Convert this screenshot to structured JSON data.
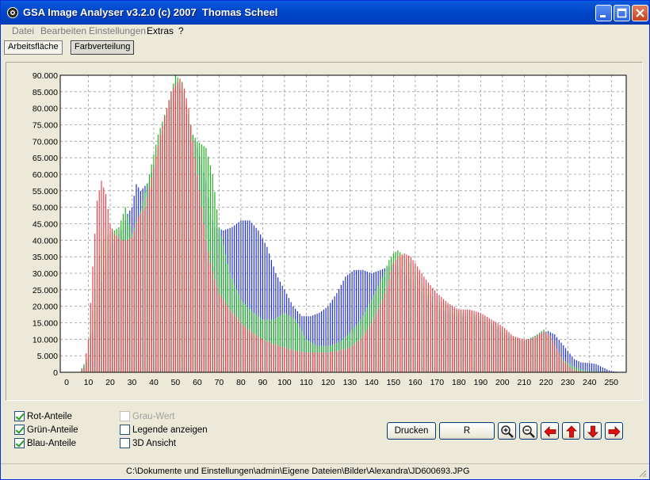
{
  "window": {
    "title": "GSA Image Analyser v3.2.0 (c) 2007  Thomas Scheel"
  },
  "menu": [
    "Datei",
    "Bearbeiten",
    "Einstellungen",
    "Extras",
    "?"
  ],
  "tabs": [
    "Arbeitsfläche",
    "Farbverteilung"
  ],
  "checkboxes": {
    "rot": {
      "label": "Rot-Anteile",
      "checked": true
    },
    "gruen": {
      "label": "Grün-Anteile",
      "checked": true
    },
    "blau": {
      "label": "Blau-Anteile",
      "checked": true
    },
    "grau": {
      "label": "Grau-Wert",
      "checked": false,
      "disabled": true
    },
    "legende": {
      "label": "Legende anzeigen",
      "checked": false
    },
    "ansicht3d": {
      "label": "3D Ansicht",
      "checked": false
    }
  },
  "buttons": {
    "drucken": "Drucken",
    "reset": "R"
  },
  "icons": [
    "zoom-in-icon",
    "zoom-out-icon",
    "arrow-left-icon",
    "arrow-up-icon",
    "arrow-down-icon",
    "arrow-right-icon"
  ],
  "status": {
    "path": "C:\\Dokumente und Einstellungen\\admin\\Eigene Dateien\\Bilder\\Alexandra\\JD600693.JPG"
  },
  "colors": {
    "red": "#e8434a",
    "green": "#1fb21f",
    "blue": "#1f2fd6"
  },
  "chart_data": {
    "type": "bar",
    "ylim": [
      0,
      90000
    ],
    "xlim": [
      0,
      255
    ],
    "y_ticks": [
      "0",
      "5.000",
      "10.000",
      "15.000",
      "20.000",
      "25.000",
      "30.000",
      "35.000",
      "40.000",
      "45.000",
      "50.000",
      "55.000",
      "60.000",
      "65.000",
      "70.000",
      "75.000",
      "80.000",
      "85.000",
      "90.000"
    ],
    "x_ticks": [
      "0",
      "10",
      "20",
      "30",
      "40",
      "50",
      "60",
      "70",
      "80",
      "90",
      "100",
      "110",
      "120",
      "130",
      "140",
      "150",
      "160",
      "170",
      "180",
      "190",
      "200",
      "210",
      "220",
      "230",
      "240",
      "250"
    ],
    "grid": true,
    "series": [
      {
        "name": "Rot-Anteile",
        "color": "#e8434a",
        "points": [
          [
            0,
            0
          ],
          [
            6,
            0
          ],
          [
            8,
            1500
          ],
          [
            10,
            10000
          ],
          [
            12,
            32000
          ],
          [
            14,
            52000
          ],
          [
            16,
            58000
          ],
          [
            18,
            54000
          ],
          [
            20,
            45000
          ],
          [
            22,
            42000
          ],
          [
            25,
            40000
          ],
          [
            28,
            40000
          ],
          [
            30,
            41000
          ],
          [
            33,
            47000
          ],
          [
            36,
            50000
          ],
          [
            40,
            62000
          ],
          [
            43,
            72000
          ],
          [
            46,
            80000
          ],
          [
            48,
            85000
          ],
          [
            50,
            87000
          ],
          [
            52,
            89000
          ],
          [
            54,
            86000
          ],
          [
            56,
            80000
          ],
          [
            58,
            70000
          ],
          [
            60,
            60000
          ],
          [
            62,
            50000
          ],
          [
            64,
            40000
          ],
          [
            66,
            33000
          ],
          [
            68,
            28000
          ],
          [
            70,
            24000
          ],
          [
            75,
            19000
          ],
          [
            80,
            15000
          ],
          [
            85,
            12000
          ],
          [
            90,
            10000
          ],
          [
            95,
            8500
          ],
          [
            100,
            7500
          ],
          [
            105,
            6500
          ],
          [
            110,
            6000
          ],
          [
            115,
            6000
          ],
          [
            120,
            6000
          ],
          [
            125,
            6500
          ],
          [
            130,
            7500
          ],
          [
            135,
            10000
          ],
          [
            140,
            15000
          ],
          [
            145,
            22000
          ],
          [
            148,
            28000
          ],
          [
            150,
            33000
          ],
          [
            152,
            35000
          ],
          [
            155,
            36000
          ],
          [
            158,
            35000
          ],
          [
            160,
            33000
          ],
          [
            165,
            28000
          ],
          [
            170,
            24000
          ],
          [
            175,
            21000
          ],
          [
            180,
            19000
          ],
          [
            185,
            19000
          ],
          [
            190,
            18000
          ],
          [
            195,
            16000
          ],
          [
            200,
            14000
          ],
          [
            205,
            11000
          ],
          [
            210,
            10000
          ],
          [
            213,
            10000
          ],
          [
            216,
            11000
          ],
          [
            219,
            12500
          ],
          [
            222,
            11000
          ],
          [
            225,
            7000
          ],
          [
            228,
            3500
          ],
          [
            231,
            1500
          ],
          [
            234,
            400
          ],
          [
            240,
            100
          ],
          [
            255,
            0
          ]
        ]
      },
      {
        "name": "Grün-Anteile",
        "color": "#1fb21f",
        "points": [
          [
            0,
            0
          ],
          [
            6,
            0
          ],
          [
            10,
            5000
          ],
          [
            13,
            25000
          ],
          [
            16,
            40000
          ],
          [
            20,
            42000
          ],
          [
            24,
            44000
          ],
          [
            27,
            50000
          ],
          [
            30,
            42000
          ],
          [
            34,
            49000
          ],
          [
            38,
            60000
          ],
          [
            42,
            72000
          ],
          [
            46,
            80000
          ],
          [
            50,
            90000
          ],
          [
            53,
            88000
          ],
          [
            56,
            78000
          ],
          [
            58,
            72000
          ],
          [
            60,
            70000
          ],
          [
            64,
            68000
          ],
          [
            67,
            60000
          ],
          [
            70,
            44000
          ],
          [
            75,
            30000
          ],
          [
            80,
            22000
          ],
          [
            85,
            18500
          ],
          [
            90,
            16000
          ],
          [
            95,
            16000
          ],
          [
            100,
            18000
          ],
          [
            105,
            16000
          ],
          [
            110,
            10000
          ],
          [
            115,
            8000
          ],
          [
            120,
            8000
          ],
          [
            125,
            9000
          ],
          [
            130,
            12000
          ],
          [
            135,
            16000
          ],
          [
            140,
            22000
          ],
          [
            145,
            29000
          ],
          [
            148,
            34000
          ],
          [
            150,
            36000
          ],
          [
            152,
            37000
          ],
          [
            155,
            35000
          ],
          [
            158,
            33000
          ],
          [
            162,
            28000
          ],
          [
            166,
            24000
          ],
          [
            170,
            22000
          ],
          [
            175,
            20000
          ],
          [
            180,
            18000
          ],
          [
            185,
            18000
          ],
          [
            190,
            17000
          ],
          [
            195,
            15000
          ],
          [
            200,
            13000
          ],
          [
            205,
            10500
          ],
          [
            210,
            9500
          ],
          [
            215,
            11000
          ],
          [
            219,
            13000
          ],
          [
            222,
            11000
          ],
          [
            225,
            7000
          ],
          [
            228,
            3800
          ],
          [
            232,
            2000
          ],
          [
            236,
            800
          ],
          [
            240,
            300
          ],
          [
            255,
            0
          ]
        ]
      },
      {
        "name": "Blau-Anteile",
        "color": "#1f2fd6",
        "points": [
          [
            0,
            0
          ],
          [
            6,
            0
          ],
          [
            10,
            4000
          ],
          [
            14,
            20000
          ],
          [
            18,
            35000
          ],
          [
            22,
            40000
          ],
          [
            26,
            44000
          ],
          [
            28,
            48000
          ],
          [
            30,
            50000
          ],
          [
            32,
            57000
          ],
          [
            34,
            55000
          ],
          [
            38,
            58000
          ],
          [
            42,
            68000
          ],
          [
            46,
            78000
          ],
          [
            50,
            88000
          ],
          [
            53,
            85000
          ],
          [
            56,
            75000
          ],
          [
            60,
            68000
          ],
          [
            64,
            58000
          ],
          [
            66,
            48000
          ],
          [
            68,
            44000
          ],
          [
            72,
            43000
          ],
          [
            76,
            44000
          ],
          [
            80,
            46000
          ],
          [
            84,
            46000
          ],
          [
            88,
            43000
          ],
          [
            92,
            38000
          ],
          [
            96,
            30000
          ],
          [
            100,
            25000
          ],
          [
            104,
            20000
          ],
          [
            108,
            17000
          ],
          [
            112,
            17000
          ],
          [
            116,
            18000
          ],
          [
            120,
            20000
          ],
          [
            124,
            24000
          ],
          [
            128,
            29000
          ],
          [
            132,
            31000
          ],
          [
            136,
            31000
          ],
          [
            140,
            30000
          ],
          [
            144,
            31000
          ],
          [
            148,
            32000
          ],
          [
            150,
            33000
          ],
          [
            154,
            31000
          ],
          [
            158,
            28000
          ],
          [
            162,
            25000
          ],
          [
            166,
            22000
          ],
          [
            170,
            20000
          ],
          [
            175,
            18000
          ],
          [
            180,
            17000
          ],
          [
            185,
            17000
          ],
          [
            190,
            16000
          ],
          [
            195,
            14000
          ],
          [
            200,
            12000
          ],
          [
            205,
            10000
          ],
          [
            210,
            9500
          ],
          [
            215,
            11000
          ],
          [
            218,
            12000
          ],
          [
            221,
            12500
          ],
          [
            224,
            11500
          ],
          [
            227,
            9000
          ],
          [
            230,
            6500
          ],
          [
            233,
            4000
          ],
          [
            236,
            3000
          ],
          [
            240,
            2800
          ],
          [
            243,
            2500
          ],
          [
            246,
            1500
          ],
          [
            250,
            300
          ],
          [
            255,
            0
          ]
        ]
      }
    ]
  }
}
